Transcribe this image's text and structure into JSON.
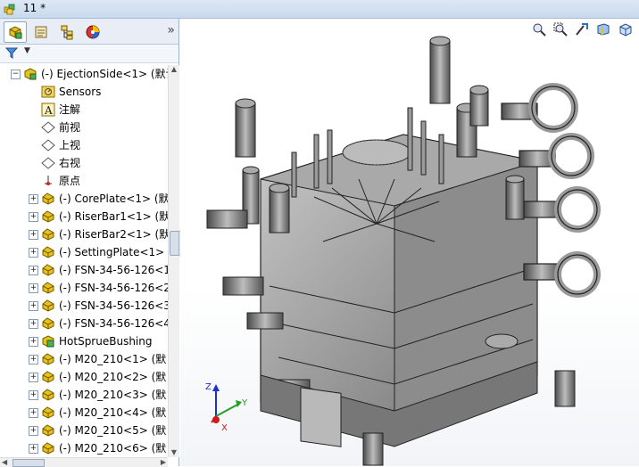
{
  "window": {
    "title": "11 *"
  },
  "panel_tabs": [
    {
      "name": "feature-manager-tab",
      "active": true
    },
    {
      "name": "property-manager-tab",
      "active": false
    },
    {
      "name": "configuration-manager-tab",
      "active": false
    },
    {
      "name": "display-manager-tab",
      "active": false
    }
  ],
  "tree": {
    "root": {
      "label": "(-) EjectionSide<1> (默认"
    },
    "items": [
      {
        "label": "Sensors",
        "icon": "sensors-icon"
      },
      {
        "label": "注解",
        "icon": "annotations-icon"
      },
      {
        "label": "前视",
        "icon": "plane-icon"
      },
      {
        "label": "上视",
        "icon": "plane-icon"
      },
      {
        "label": "右视",
        "icon": "plane-icon"
      },
      {
        "label": "原点",
        "icon": "origin-icon"
      },
      {
        "label": "(-) CorePlate<1> (默",
        "icon": "part-icon"
      },
      {
        "label": "(-) RiserBar1<1> (默",
        "icon": "part-icon"
      },
      {
        "label": "(-) RiserBar2<1> (默",
        "icon": "part-icon"
      },
      {
        "label": "(-) SettingPlate<1> (",
        "icon": "part-icon"
      },
      {
        "label": "(-) FSN-34-56-126<1",
        "icon": "part-icon"
      },
      {
        "label": "(-) FSN-34-56-126<2",
        "icon": "part-icon"
      },
      {
        "label": "(-) FSN-34-56-126<3",
        "icon": "part-icon"
      },
      {
        "label": "(-) FSN-34-56-126<4",
        "icon": "part-icon"
      },
      {
        "label": "HotSprueBushing",
        "icon": "subassembly-icon"
      },
      {
        "label": "(-) M20_210<1> (默",
        "icon": "part-icon"
      },
      {
        "label": "(-) M20_210<2> (默",
        "icon": "part-icon"
      },
      {
        "label": "(-) M20_210<3> (默",
        "icon": "part-icon"
      },
      {
        "label": "(-) M20_210<4> (默",
        "icon": "part-icon"
      },
      {
        "label": "(-) M20_210<5> (默",
        "icon": "part-icon"
      },
      {
        "label": "(-) M20_210<6> (默",
        "icon": "part-icon"
      }
    ]
  },
  "triad": {
    "x": "X",
    "y": "Y",
    "z": "Z"
  },
  "colors": {
    "accent": "#2e6fbf",
    "part_yellow": "#e8c21a",
    "viewport_bg": "#ffffff"
  },
  "headsup_tools": [
    "zoom-to-fit-icon",
    "zoom-area-icon",
    "previous-view-icon",
    "section-view-icon",
    "view-orientation-icon"
  ]
}
